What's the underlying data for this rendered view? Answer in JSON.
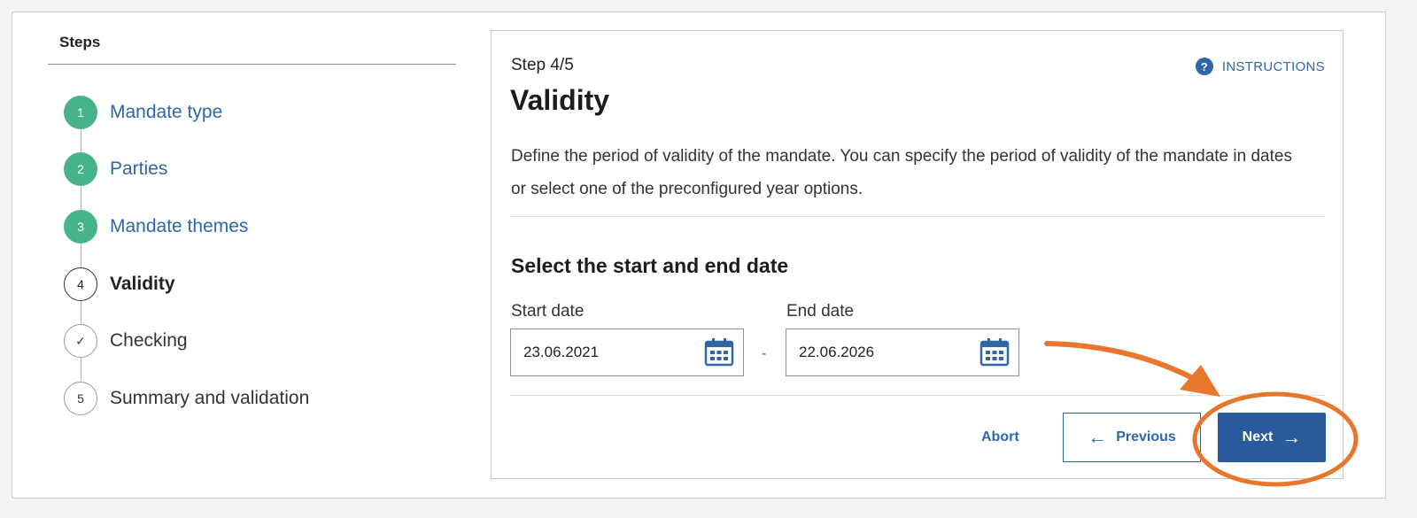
{
  "sidebar": {
    "title": "Steps",
    "steps": [
      {
        "num": "1",
        "label": "Mandate type",
        "state": "done"
      },
      {
        "num": "2",
        "label": "Parties",
        "state": "done"
      },
      {
        "num": "3",
        "label": "Mandate themes",
        "state": "done"
      },
      {
        "num": "4",
        "label": "Validity",
        "state": "current"
      },
      {
        "num": "✓",
        "label": "Checking",
        "state": "todo"
      },
      {
        "num": "5",
        "label": "Summary and validation",
        "state": "todo"
      }
    ]
  },
  "panel": {
    "step_count": "Step 4/5",
    "title": "Validity",
    "instructions_label": "INSTRUCTIONS",
    "instructions_icon": "question-circle-icon",
    "description": "Define the period of validity of the mandate. You can specify the period of validity of the mandate in dates or select one of the preconfigured year options.",
    "subheading": "Select the start and end date",
    "start_date": {
      "label": "Start date",
      "value": "23.06.2021"
    },
    "separator": "-",
    "end_date": {
      "label": "End date",
      "value": "22.06.2026"
    },
    "calendar_icon": "calendar-icon"
  },
  "actions": {
    "abort": "Abort",
    "previous": "Previous",
    "next": "Next",
    "previous_icon": "arrow-left-icon",
    "next_icon": "arrow-right-icon"
  },
  "colors": {
    "accent": "#2f67a8",
    "primary_button": "#2a5a9b",
    "step_done": "#47b38a",
    "annotation": "#e8762c"
  }
}
